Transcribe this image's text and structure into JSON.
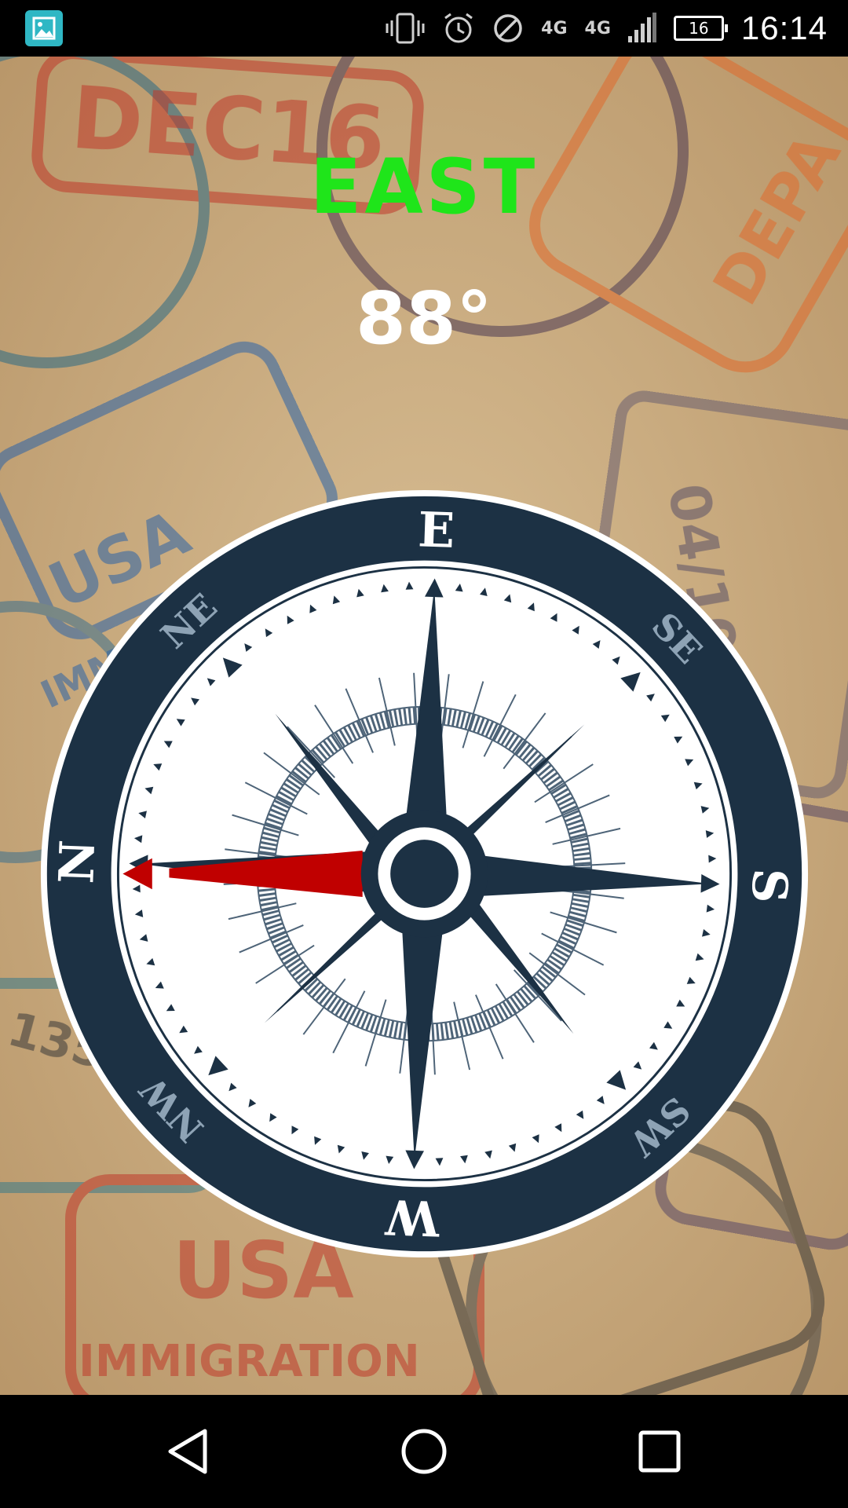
{
  "status_bar": {
    "app_icon": "gallery-icon",
    "icons": [
      "vibrate-icon",
      "alarm-icon",
      "blocked-icon",
      "signal-icon"
    ],
    "network_1": "4G",
    "network_2": "4G",
    "battery_level": "16",
    "time": "16:14"
  },
  "compass": {
    "direction": "EAST",
    "heading_value": "88°",
    "heading_degrees": 88,
    "cardinal_labels": [
      "E",
      "SE",
      "S",
      "SW",
      "W",
      "NW",
      "N",
      "NE"
    ],
    "needle_color": "#c00000",
    "ring_color": "#1c3144"
  },
  "colors": {
    "direction_text": "#1fe51a",
    "degree_text": "#ffffff"
  },
  "navbar": {
    "back": "back-icon",
    "home": "home-icon",
    "recents": "recents-icon"
  }
}
